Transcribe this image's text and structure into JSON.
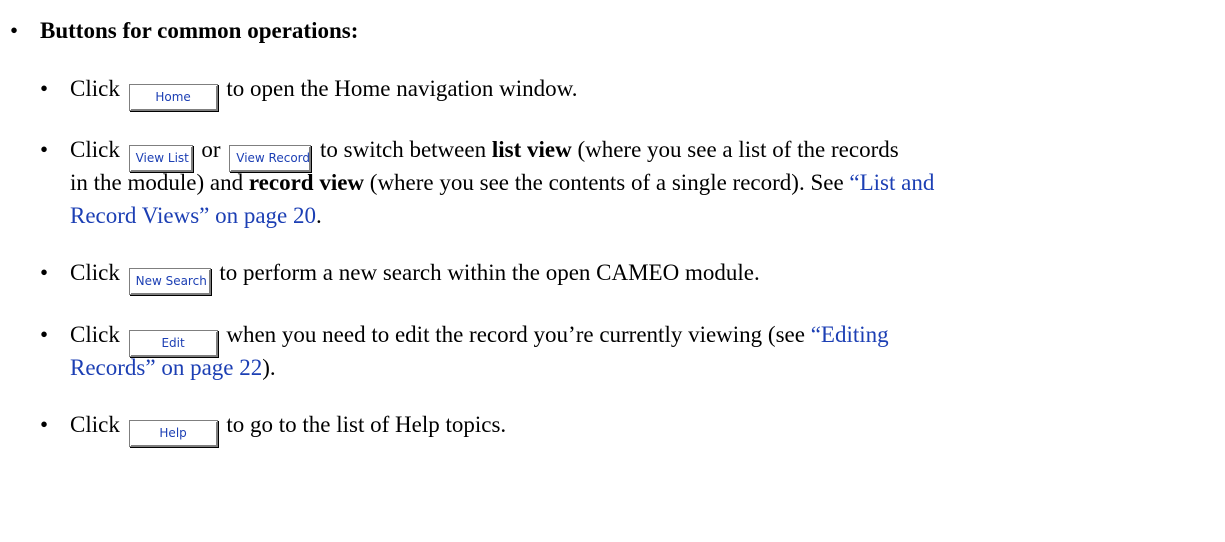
{
  "heading": "Buttons for common operations:",
  "bullets": {
    "home": {
      "pre": "Click",
      "button": "Home",
      "post": "to open the Home navigation window."
    },
    "views": {
      "pre": "Click",
      "button1": "View List",
      "mid": "or",
      "button2": "View Record",
      "t1": "to switch between",
      "b1": "list view",
      "t2": "(where you see a list of the records",
      "t3": "in the module) and",
      "b2": "record view",
      "t4": "(where you see the contents of a single record). See",
      "link1": "“List and",
      "link2": "Record Views” on page 20",
      "t5": "."
    },
    "search": {
      "pre": "Click",
      "button": "New Search",
      "post": "to perform a new search within the open CAMEO module."
    },
    "edit": {
      "pre": "Click",
      "button": "Edit",
      "post": "when you need to edit the record you’re currently viewing (see",
      "link1": "“Editing",
      "link2": "Records” on page 22",
      "post2": ")."
    },
    "help": {
      "pre": "Click",
      "button": "Help",
      "post": "to go to the list of Help topics."
    }
  },
  "colors": {
    "link": "#1c3fb4",
    "text": "#000000"
  }
}
